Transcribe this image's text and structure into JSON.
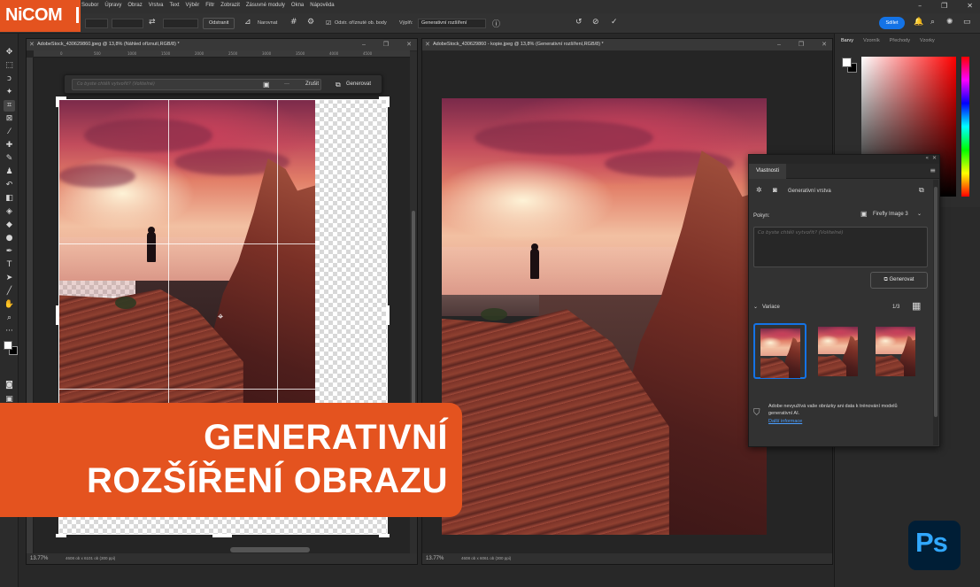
{
  "brand": {
    "logo_text": "NiCOM"
  },
  "menu": {
    "items": [
      "Soubor",
      "Úpravy",
      "Obraz",
      "Vrstva",
      "Text",
      "Výběr",
      "Filtr",
      "Zobrazit",
      "Zásuvné moduly",
      "Okna",
      "Nápověda"
    ]
  },
  "options_bar": {
    "delete_label": "Odstranit",
    "straighten_label": "Narovnat",
    "delete_cropped_label": "Odstr. oříznuté ob. body",
    "fill_label": "Výplň:",
    "fill_value": "Generativní rozšíření",
    "share_label": "Sdílet"
  },
  "doc_left": {
    "tab_title": "AdobeStock_430629860.jpeg @ 13,8% (Náhled oříznutí,RGB/8) *",
    "zoom": "13.77%",
    "status_meta": "4608 ob x 6101 ob (300 ppi)",
    "ruler_ticks": [
      "0",
      "500",
      "1000",
      "1500",
      "2000",
      "2500",
      "3000",
      "3500",
      "4000",
      "4500"
    ]
  },
  "doc_right": {
    "tab_title": "AdobeStock_430629860 - kopie.jpeg @ 13,8% (Generativní rozšíření,RGB/8) *",
    "zoom": "13.77%",
    "status_meta": "4608 ob x 6061 ob (300 ppi)"
  },
  "context_bar": {
    "prompt_placeholder": "Co byste chtěli vytvořit? (Volitelné)",
    "cancel_label": "Zrušit",
    "generate_label": "Generovat"
  },
  "color_panel": {
    "tabs": [
      "Barvy",
      "Vzorník",
      "Přechody",
      "Vzorky"
    ]
  },
  "properties": {
    "tab": "Vlastnosti",
    "layer_type": "Generativní vrstva",
    "prompt_label": "Pokyn:",
    "model": "Firefly Image 3",
    "prompt_placeholder": "Co byste chtěli vytvořit? (Volitelné)",
    "generate_label": "Generovat",
    "variations_label": "Variace",
    "variations_count": "1/3",
    "notice": "Adobe nevyužívá vaše obrázky ani data k trénování modelů generativní AI.",
    "more_info": "Další informace"
  },
  "banner": {
    "line1": "GENERATIVNÍ",
    "line2": "ROZŠÍŘENÍ OBRAZU"
  },
  "badge": {
    "text": "Ps"
  },
  "colors": {
    "accent_orange": "#e4531f",
    "adobe_blue": "#1473e6",
    "ps_blue": "#31a8ff",
    "ps_navy": "#001e36"
  }
}
